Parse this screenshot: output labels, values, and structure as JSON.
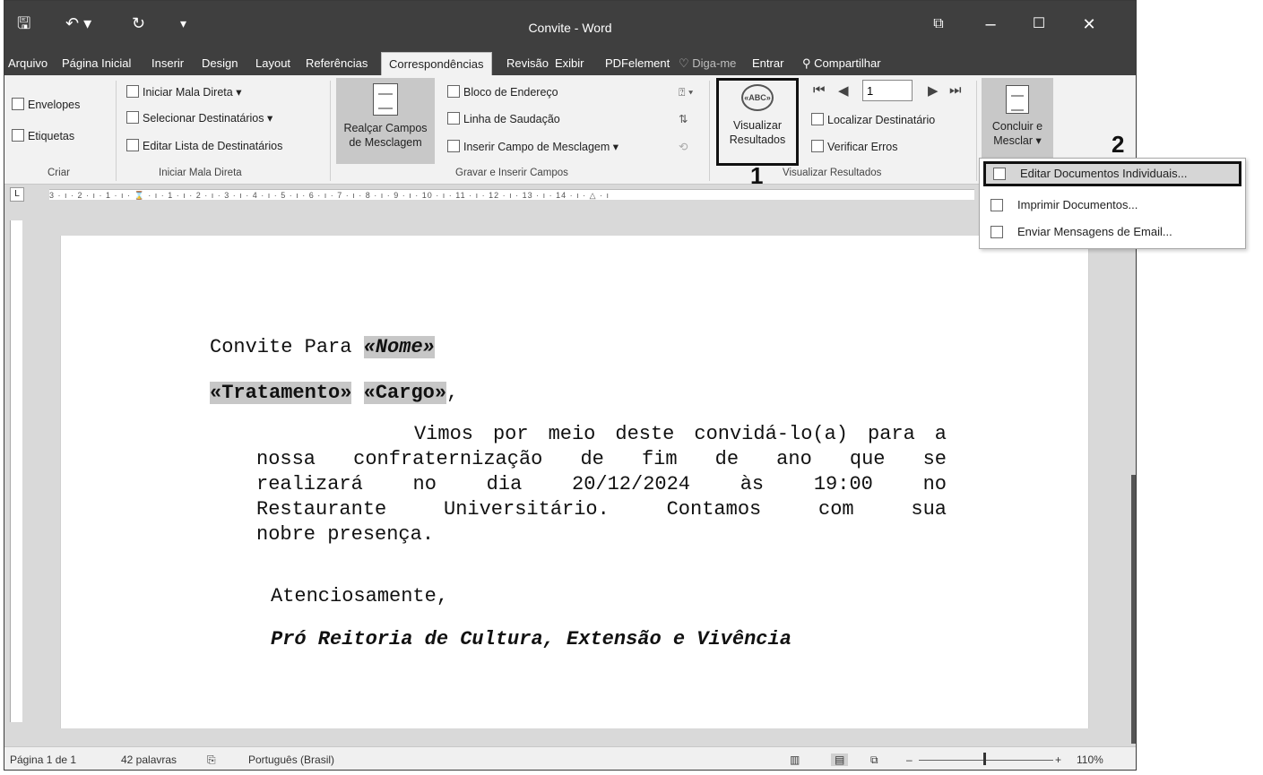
{
  "window": {
    "title": "Convite - Word",
    "qat": {
      "save": "🖫",
      "undo": "↶ ▾",
      "redo": "↻",
      "customize": "▾"
    },
    "controls": {
      "ribbon_display": "⧉",
      "minimize": "–",
      "maximize": "☐",
      "close": "✕"
    }
  },
  "menu": {
    "tabs": [
      "Arquivo",
      "Página Inicial",
      "Inserir",
      "Design",
      "Layout",
      "Referências",
      "Correspondências",
      "Revisão",
      "Exibir",
      "PDFelement"
    ],
    "tell_me": "♡ Diga-me",
    "signin": "Entrar",
    "share": "Compartilhar",
    "active_tab": "Correspondências"
  },
  "ribbon": {
    "criar": {
      "envelopes": "Envelopes",
      "etiquetas": "Etiquetas",
      "group": "Criar"
    },
    "iniciar": {
      "iniciar_mala": "Iniciar Mala Direta ▾",
      "selecionar": "Selecionar Destinatários ▾",
      "editar_lista": "Editar Lista de Destinatários",
      "group": "Iniciar Mala Direta"
    },
    "gravar": {
      "realcar_line1": "Realçar Campos",
      "realcar_line2": "de Mesclagem",
      "bloco": "Bloco de Endereço",
      "linha": "Linha de Saudação",
      "inserir_campo": "Inserir Campo de Mesclagem ▾",
      "group": "Gravar e Inserir Campos"
    },
    "visualizar": {
      "btn_line1": "Visualizar",
      "btn_line2": "Resultados",
      "record": "1",
      "localizar": "Localizar Destinatário",
      "verificar": "Verificar Erros",
      "group": "Visualizar Resultados"
    },
    "concluir": {
      "line1": "Concluir e",
      "line2": "Mesclar ▾"
    }
  },
  "callouts": {
    "one": "1",
    "two": "2"
  },
  "dropdown": {
    "items": [
      "Editar Documentos Individuais...",
      "Imprimir Documentos...",
      "Enviar Mensagens de Email..."
    ]
  },
  "ruler": {
    "ticks": "3 · ı · 2 · ı · 1 · ı · ⌛ · ı · 1 · ı · 2 · ı · 3 · ı · 4 · ı · 5 · ı · 6 · ı · 7 · ı · 8 · ı · 9 · ı · 10 · ı · 11 · ı · 12 · ı · 13 · ı · 14 · ı · △ · ı"
  },
  "document": {
    "line1_prefix": "Convite Para ",
    "field_nome": "«Nome»",
    "field_tratamento": "«Tratamento»",
    "field_cargo": "«Cargo»",
    "comma": ",",
    "body_lines": [
      "        Vimos por meio deste convidá-lo(a) para a",
      "nossa confraternização de fim de ano que se",
      "realizará no dia 20/12/2024 às 19:00 no",
      "Restaurante Universitário. Contamos com sua",
      "nobre presença."
    ],
    "closing": "Atenciosamente,",
    "signature": "Pró Reitoria de Cultura, Extensão e Vivência"
  },
  "status": {
    "page": "Página 1 de 1",
    "words": "42 palavras",
    "language": "Português (Brasil)",
    "zoom": "110%"
  }
}
